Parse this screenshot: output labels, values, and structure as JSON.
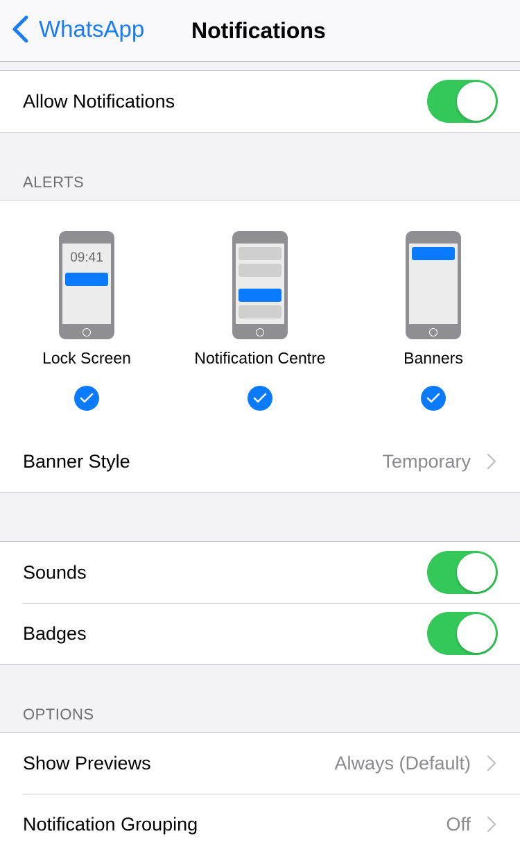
{
  "navbar": {
    "back_label": "WhatsApp",
    "title": "Notifications"
  },
  "allow_notifications": {
    "label": "Allow Notifications",
    "enabled": true
  },
  "alerts": {
    "header": "ALERTS",
    "styles": [
      {
        "label": "Lock Screen",
        "checked": true,
        "clock": "09:41"
      },
      {
        "label": "Notification Centre",
        "checked": true
      },
      {
        "label": "Banners",
        "checked": true
      }
    ],
    "banner_style": {
      "label": "Banner Style",
      "value": "Temporary"
    }
  },
  "sounds": {
    "label": "Sounds",
    "enabled": true
  },
  "badges": {
    "label": "Badges",
    "enabled": true
  },
  "options": {
    "header": "OPTIONS",
    "show_previews": {
      "label": "Show Previews",
      "value": "Always (Default)"
    },
    "notification_grouping": {
      "label": "Notification Grouping",
      "value": "Off"
    }
  },
  "colors": {
    "accent": "#0a7aff",
    "toggle_on": "#34c759"
  }
}
